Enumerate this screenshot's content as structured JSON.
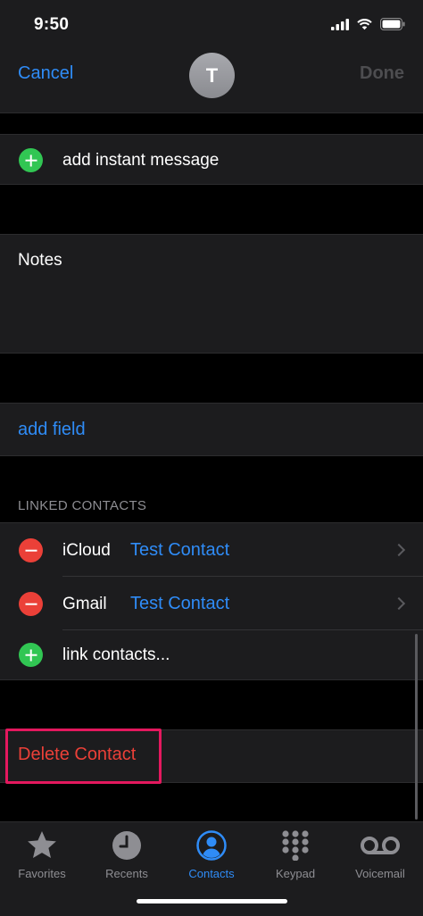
{
  "status_bar": {
    "time": "9:50"
  },
  "nav": {
    "cancel_label": "Cancel",
    "avatar_initial": "T",
    "done_label": "Done"
  },
  "instant_message": {
    "label": "add instant message"
  },
  "notes": {
    "label": "Notes"
  },
  "add_field": {
    "label": "add field"
  },
  "linked_contacts": {
    "header": "LINKED CONTACTS",
    "items": [
      {
        "source": "iCloud",
        "name": "Test Contact"
      },
      {
        "source": "Gmail",
        "name": "Test Contact"
      }
    ],
    "link_label": "link contacts..."
  },
  "delete": {
    "label": "Delete Contact"
  },
  "tabs": [
    {
      "label": "Favorites",
      "icon": "star-icon",
      "active": false
    },
    {
      "label": "Recents",
      "icon": "clock-icon",
      "active": false
    },
    {
      "label": "Contacts",
      "icon": "person-icon",
      "active": true
    },
    {
      "label": "Keypad",
      "icon": "keypad-icon",
      "active": false
    },
    {
      "label": "Voicemail",
      "icon": "voicemail-icon",
      "active": false
    }
  ],
  "colors": {
    "accent": "#2f8cf7",
    "destructive": "#eb4038",
    "add": "#31c653",
    "highlight": "#e4185e"
  }
}
